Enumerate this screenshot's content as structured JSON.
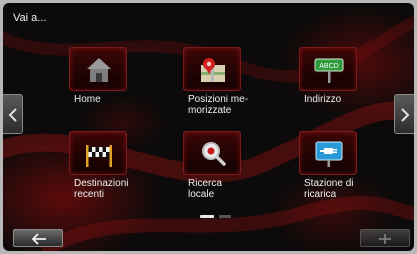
{
  "header": {
    "title": "Vai a..."
  },
  "tiles": [
    {
      "label": "Home",
      "icon": "home-icon"
    },
    {
      "label": "Posizioni me-\nmorizzate",
      "icon": "saved-map-pin-icon"
    },
    {
      "label": "Indirizzo",
      "icon": "address-sign-icon",
      "sign_text": "ABCD"
    },
    {
      "label": "Destinazioni\nrecenti",
      "icon": "checkered-flag-icon"
    },
    {
      "label": "Ricerca\nlocale",
      "icon": "local-search-icon"
    },
    {
      "label": "Stazione di\nricarica",
      "icon": "charging-station-icon"
    }
  ],
  "navigation": {
    "left": "chevron-left-icon",
    "right": "chevron-right-icon"
  },
  "pager": {
    "current_page": 1,
    "total_pages": 2
  },
  "footer": {
    "back": "back-arrow-icon",
    "add": "plus-icon"
  },
  "colors": {
    "accent_red": "#8a1010",
    "tile_border": "#7a1a1a",
    "text": "#f0f0f0"
  }
}
